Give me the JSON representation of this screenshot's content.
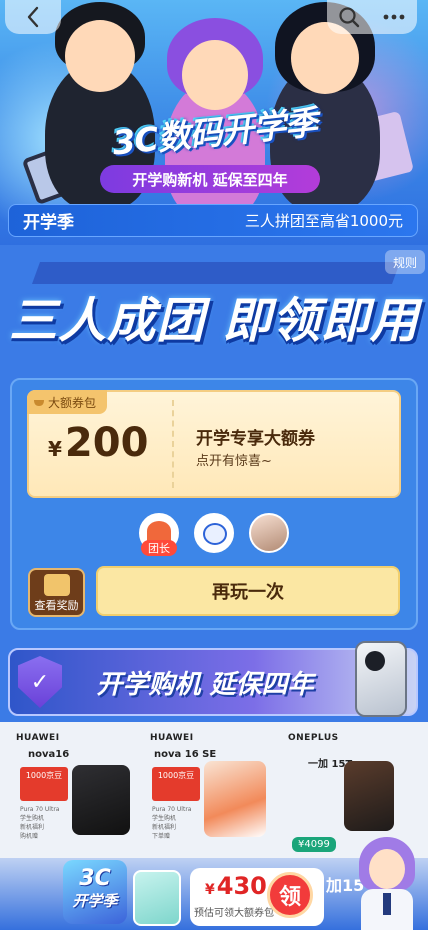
{
  "nav": {
    "back_icon": "chevron-left-icon",
    "search_icon": "search-icon",
    "more_icon": "more-dots-icon"
  },
  "hero": {
    "event_title": "3C数码开学季",
    "event_subtitle": "开学购新机 延保至四年"
  },
  "promo_bar": {
    "left": "开学季",
    "right": "三人拼团至高省1000元"
  },
  "rules_label": "规则",
  "big_title": "三人成团 即领即用",
  "coupon": {
    "tag": "大额券包",
    "currency": "¥",
    "amount": "200",
    "title": "开学专享大额券",
    "desc": "点开有惊喜~"
  },
  "team": {
    "leader_badge": "团长"
  },
  "actions": {
    "view_reward": "查看奖励",
    "play_again": "再玩一次"
  },
  "banner2": {
    "shield_mark": "✓",
    "text": "开学购机 延保四年"
  },
  "products": [
    {
      "brand": "HUAWEI",
      "model": "nova16",
      "sticker": "1000京豆",
      "specs": [
        "Pura 70 Ultra",
        "学生购机",
        "新机福利",
        "购机赠"
      ]
    },
    {
      "brand": "HUAWEI",
      "model": "nova 16 SE",
      "sticker": "1000京豆",
      "specs": [
        "Pura 70 Ultra",
        "学生购机",
        "新机福利",
        "下单赠"
      ]
    },
    {
      "brand": "ONEPLUS",
      "model": "一加 15T",
      "sticker": "",
      "price": "¥4099"
    }
  ],
  "bottom_float": {
    "logo_line1": "3C",
    "logo_line2": "开学季",
    "currency": "¥",
    "amount": "430",
    "coupon_text": "预估可领大额券包",
    "claim_label": "领",
    "add_text": "加15"
  },
  "colors": {
    "page_bg": "#3b7be6",
    "coupon_bg": "#fff4d9",
    "play_again_bg": "#fbe7a3",
    "accent_red": "#e02525"
  }
}
